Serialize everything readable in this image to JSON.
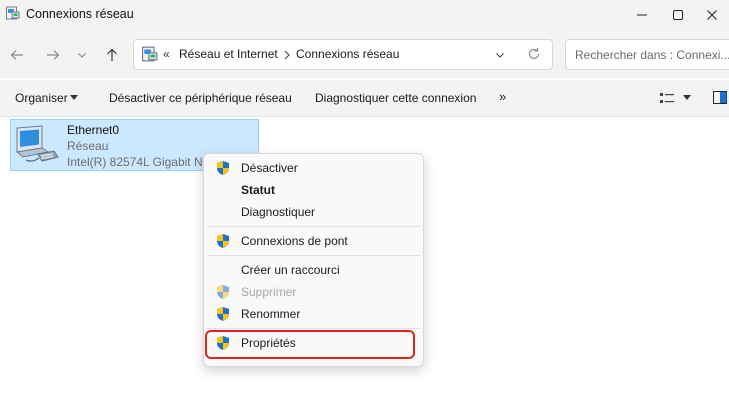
{
  "window": {
    "title": "Connexions réseau",
    "icon": "network-connections-icon",
    "controls": [
      "minimize-icon",
      "maximize-icon",
      "close-icon"
    ]
  },
  "nav": {
    "back_icon": "arrow-left-icon",
    "forward_icon": "arrow-right-icon",
    "recent_icon": "chevron-down-icon",
    "up_icon": "arrow-up-icon",
    "breadcrumb": {
      "overflow": "«",
      "items": [
        "Réseau et Internet",
        "Connexions réseau"
      ]
    },
    "refresh_icon": "refresh-icon",
    "search_placeholder": "Rechercher dans : Connexi..."
  },
  "commandbar": {
    "organize": "Organiser",
    "disable": "Désactiver ce périphérique réseau",
    "diagnose": "Diagnostiquer cette connexion",
    "more": "»"
  },
  "connection": {
    "name": "Ethernet0",
    "type": "Réseau",
    "adapter": "Intel(R) 82574L Gigabit Net"
  },
  "context_menu": {
    "items": [
      {
        "label": "Désactiver",
        "shield": true
      },
      {
        "label": "Statut",
        "bold": true
      },
      {
        "label": "Diagnostiquer"
      },
      {
        "label": "Connexions de pont",
        "shield": true
      },
      {
        "label": "Créer un raccourci"
      },
      {
        "label": "Supprimer",
        "shield": true,
        "disabled": true
      },
      {
        "label": "Renommer",
        "shield": true
      },
      {
        "label": "Propriétés",
        "shield": true,
        "highlighted": true
      }
    ]
  },
  "colors": {
    "selection_bg": "#cce8ff",
    "selection_border": "#99d1ff",
    "highlight_box": "#e0231c",
    "shield_blue": "#1f6fd1",
    "shield_yellow": "#f6c319"
  }
}
